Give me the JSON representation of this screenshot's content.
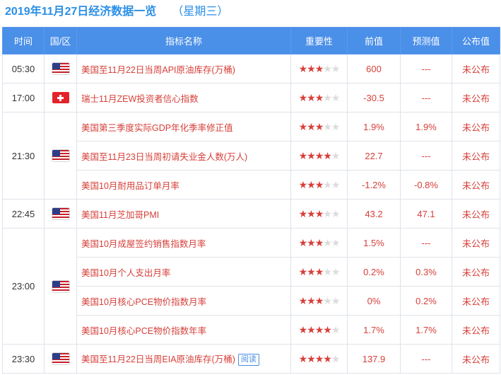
{
  "header": {
    "date_title": "2019年11月27日经济数据一览",
    "weekday": "（星期三）"
  },
  "table": {
    "columns": [
      "时间",
      "国/区",
      "指标名称",
      "重要性",
      "前值",
      "预测值",
      "公布值"
    ],
    "groups": [
      {
        "time": "05:30",
        "flag": "us-flag-icon",
        "rows": [
          {
            "name": "美国至11月22日当周API原油库存(万桶)",
            "importance": 3,
            "previous": "600",
            "forecast": "---",
            "actual": "未公布"
          }
        ]
      },
      {
        "time": "17:00",
        "flag": "switzerland-flag-icon",
        "rows": [
          {
            "name": "瑞士11月ZEW投资者信心指数",
            "importance": 3,
            "previous": "-30.5",
            "forecast": "---",
            "actual": "未公布"
          }
        ]
      },
      {
        "time": "21:30",
        "flag": "us-flag-icon",
        "rows": [
          {
            "name": "美国第三季度实际GDP年化季率修正值",
            "importance": 3,
            "previous": "1.9%",
            "forecast": "1.9%",
            "actual": "未公布"
          },
          {
            "name": "美国至11月23日当周初请失业金人数(万人)",
            "importance": 4,
            "previous": "22.7",
            "forecast": "---",
            "actual": "未公布"
          },
          {
            "name": "美国10月耐用品订单月率",
            "importance": 3,
            "previous": "-1.2%",
            "forecast": "-0.8%",
            "actual": "未公布"
          }
        ]
      },
      {
        "time": "22:45",
        "flag": "us-flag-icon",
        "rows": [
          {
            "name": "美国11月芝加哥PMI",
            "importance": 3,
            "previous": "43.2",
            "forecast": "47.1",
            "actual": "未公布"
          }
        ]
      },
      {
        "time": "23:00",
        "flag": "us-flag-icon",
        "rows": [
          {
            "name": "美国10月成屋签约销售指数月率",
            "importance": 3,
            "previous": "1.5%",
            "forecast": "---",
            "actual": "未公布"
          },
          {
            "name": "美国10月个人支出月率",
            "importance": 3,
            "previous": "0.2%",
            "forecast": "0.3%",
            "actual": "未公布"
          },
          {
            "name": "美国10月核心PCE物价指数月率",
            "importance": 3,
            "previous": "0%",
            "forecast": "0.2%",
            "actual": "未公布"
          },
          {
            "name": "美国10月核心PCE物价指数年率",
            "importance": 4,
            "previous": "1.7%",
            "forecast": "1.7%",
            "actual": "未公布"
          }
        ]
      },
      {
        "time": "23:30",
        "flag": "us-flag-icon",
        "rows": [
          {
            "name": "美国至11月22日当周EIA原油库存(万桶)",
            "badge": "阅读",
            "importance": 4,
            "previous": "137.9",
            "forecast": "---",
            "actual": "未公布"
          }
        ]
      }
    ],
    "max_stars": 5
  },
  "colors": {
    "header_bg": "#4a8fe8",
    "title": "#2b8fe6",
    "value_red": "#d6403a",
    "star_off": "#dcdcdc"
  }
}
